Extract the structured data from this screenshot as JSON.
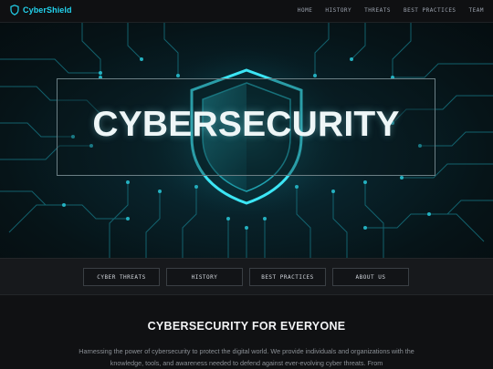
{
  "navbar": {
    "brand": "CyberShield",
    "brand_icon": "shield-icon",
    "accent_color": "#22d3ee",
    "links": [
      "HOME",
      "HISTORY",
      "THREATS",
      "BEST PRACTICES",
      "TEAM"
    ]
  },
  "hero": {
    "title": "CYBERSECURITY",
    "background_image": "glowing shield over circuit board"
  },
  "subnav": {
    "buttons": [
      "CYBER THREATS",
      "HISTORY",
      "BEST PRACTICES",
      "ABOUT US"
    ]
  },
  "section": {
    "title": "CYBERSECURITY FOR EVERYONE",
    "text": "Harnessing the power of cybersecurity to protect the digital world. We provide individuals and organizations with the knowledge, tools, and awareness needed to defend against ever-evolving cyber threats. From"
  }
}
